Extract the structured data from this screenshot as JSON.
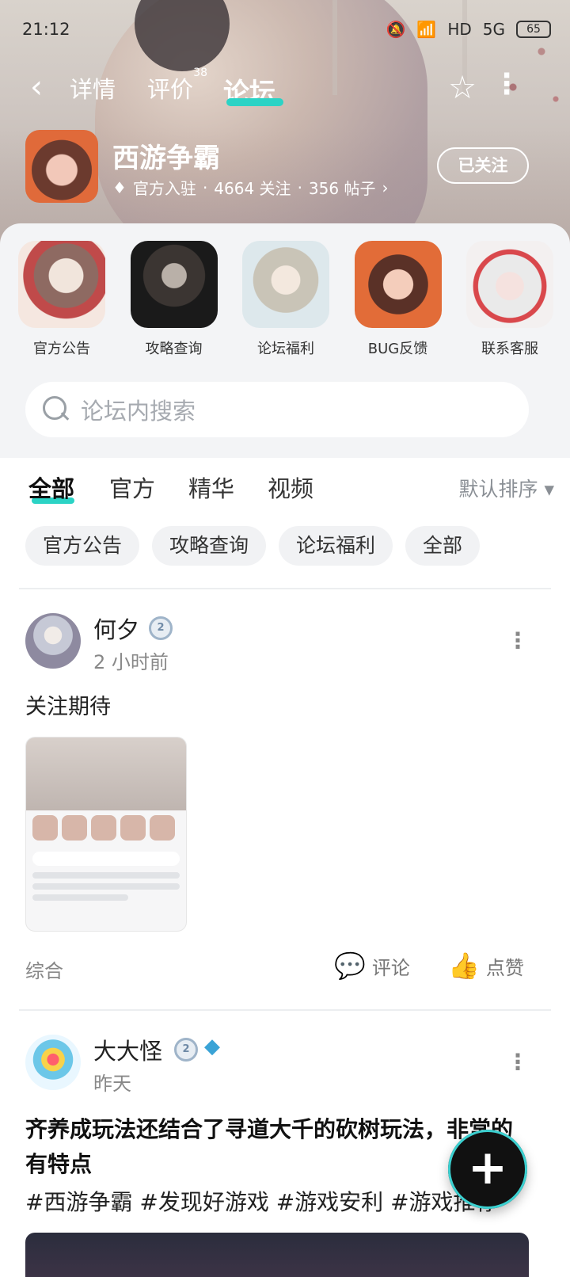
{
  "status_bar": {
    "time": "21:12",
    "network": "5G",
    "hd": "HD",
    "battery": "65"
  },
  "nav": {
    "tabs": [
      {
        "label": "详情"
      },
      {
        "label": "评价",
        "badge": "38"
      },
      {
        "label": "论坛",
        "active": true
      }
    ]
  },
  "game": {
    "name": "西游争霸",
    "official": "官方入驻",
    "followers": "4664 关注",
    "posts": "356 帖子",
    "follow_button": "已关注",
    "sep": "·",
    "arrow": "›"
  },
  "shortcuts": [
    {
      "label": "官方公告"
    },
    {
      "label": "攻略查询"
    },
    {
      "label": "论坛福利"
    },
    {
      "label": "BUG反馈"
    },
    {
      "label": "联系客服"
    }
  ],
  "search": {
    "placeholder": "论坛内搜索"
  },
  "filter_tabs": [
    {
      "label": "全部",
      "active": true
    },
    {
      "label": "官方"
    },
    {
      "label": "精华"
    },
    {
      "label": "视频"
    }
  ],
  "sort_label": "默认排序 ▾",
  "chips": [
    "官方公告",
    "攻略查询",
    "论坛福利",
    "全部"
  ],
  "posts": [
    {
      "user": "何夕",
      "level": "2",
      "time": "2 小时前",
      "text": "关注期待",
      "category": "综合",
      "comment_label": "评论",
      "like_label": "点赞"
    },
    {
      "user": "大大怪",
      "level": "2",
      "time": "昨天",
      "title": "齐养成玩法还结合了寻道大千的砍树玩法，非常的有特点",
      "tags": "#西游争霸 #发现好游戏 #游戏安利 #游戏推荐"
    }
  ],
  "colors": {
    "accent": "#2bd3c5"
  },
  "icons": [
    "back-arrow-icon",
    "star-icon",
    "more-vertical-icon",
    "diamond-icon",
    "search-icon",
    "comment-icon",
    "thumbs-up-icon",
    "plus-icon",
    "crystal-icon"
  ]
}
